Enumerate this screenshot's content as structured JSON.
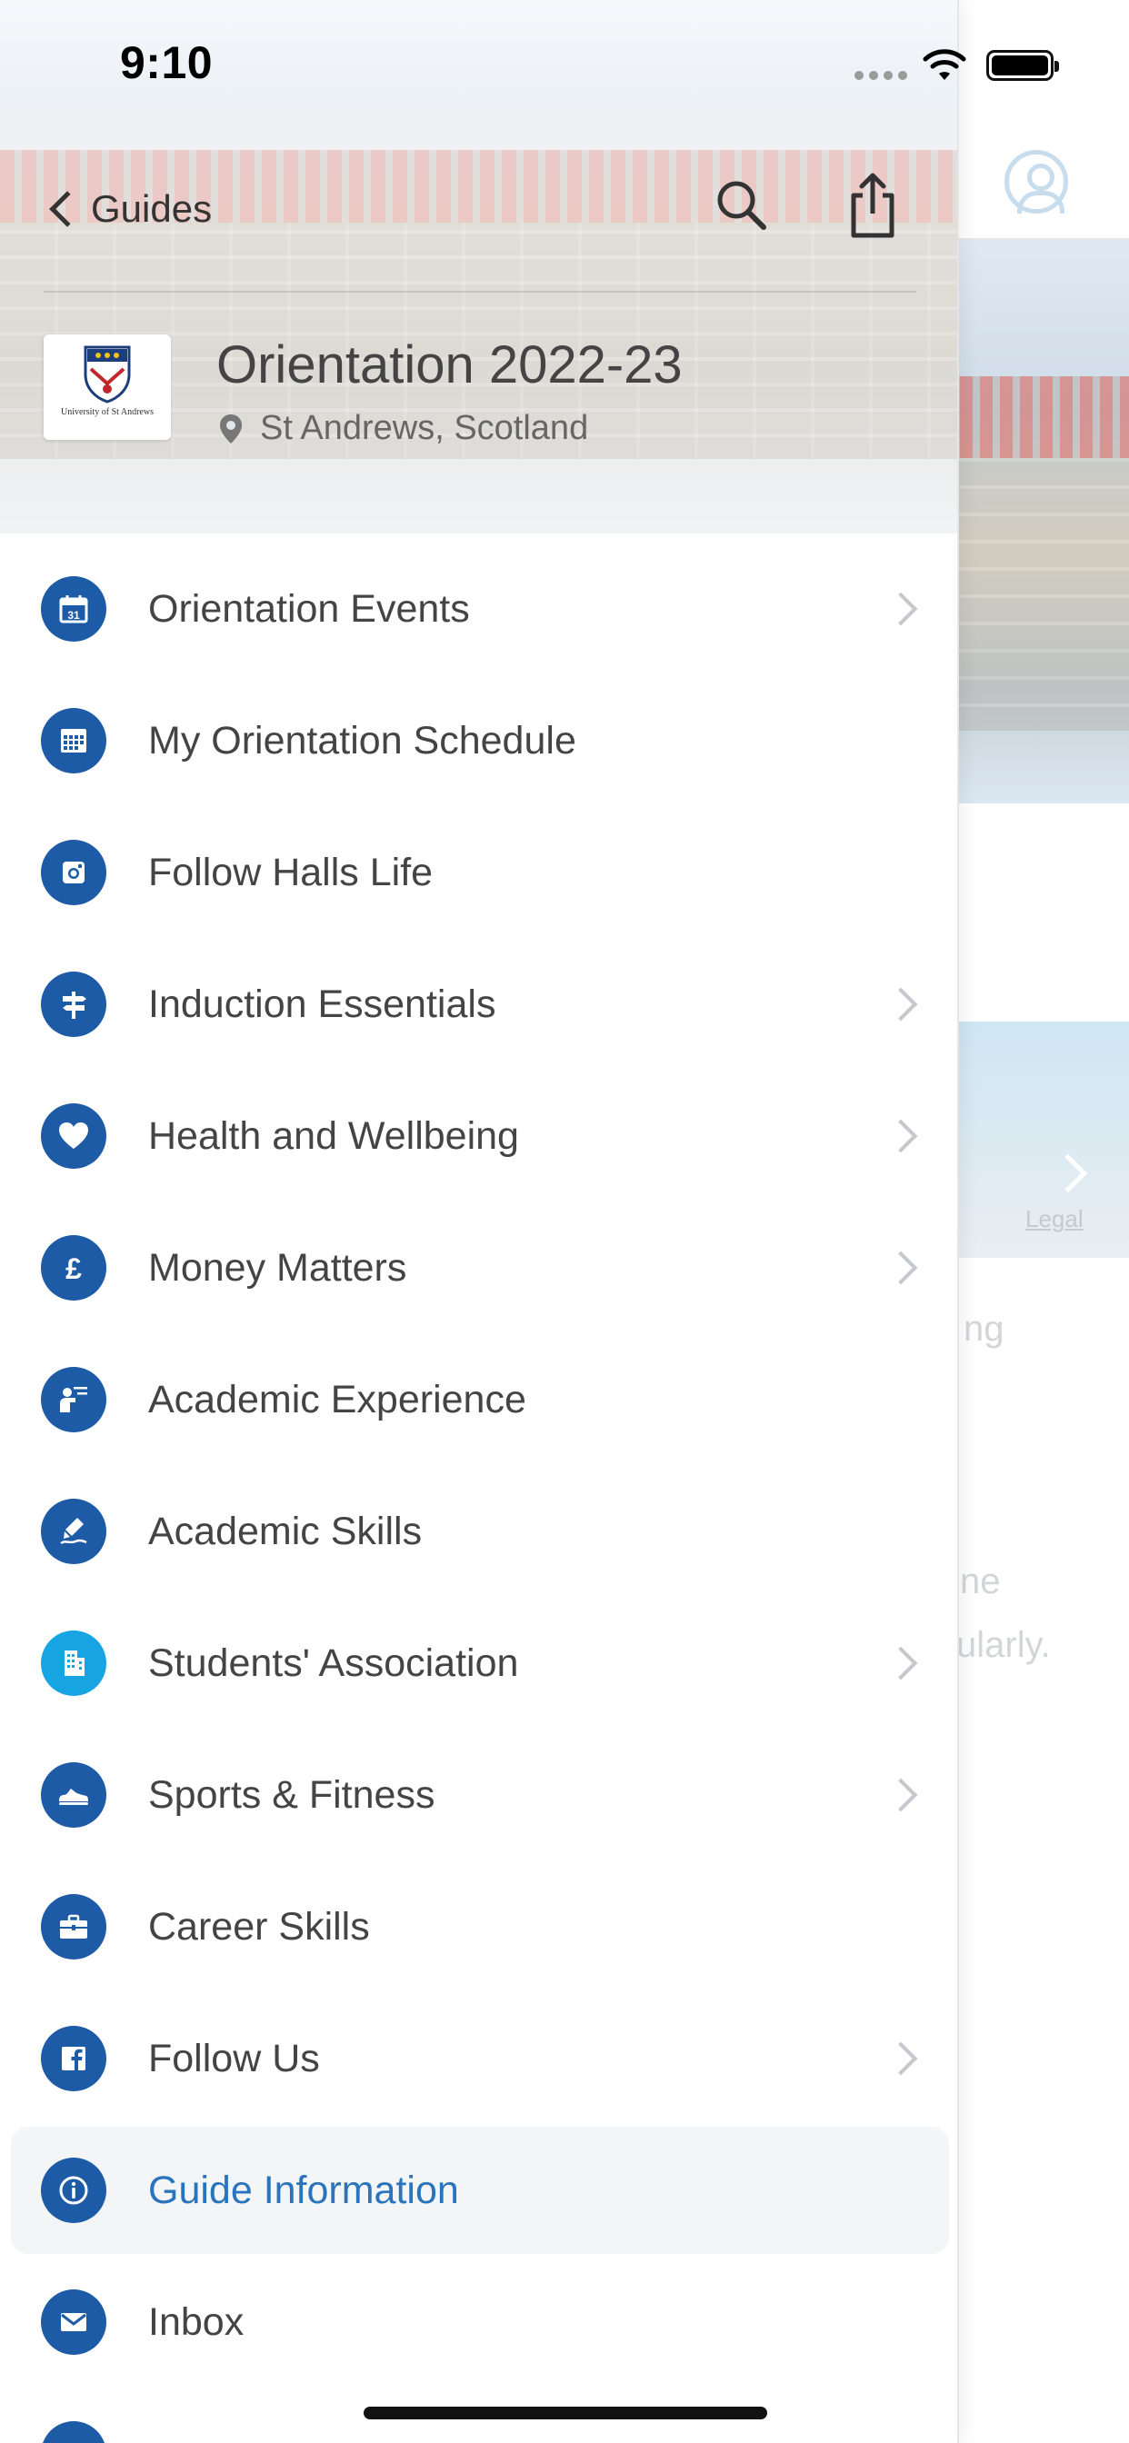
{
  "status_bar": {
    "time": "9:10"
  },
  "nav": {
    "back_label": "Guides"
  },
  "guide": {
    "title": "Orientation 2022-23",
    "location": "St Andrews, Scotland",
    "logo_text": "University of St Andrews"
  },
  "menu": {
    "items": [
      {
        "label": "Orientation Events",
        "icon": "calendar-icon",
        "chevron": true
      },
      {
        "label": "My Orientation Schedule",
        "icon": "schedule-grid-icon",
        "chevron": false
      },
      {
        "label": "Follow Halls Life",
        "icon": "instagram-icon",
        "chevron": false
      },
      {
        "label": "Induction Essentials",
        "icon": "signpost-icon",
        "chevron": true
      },
      {
        "label": "Health and Wellbeing",
        "icon": "heart-icon",
        "chevron": true
      },
      {
        "label": "Money Matters",
        "icon": "pound-icon",
        "chevron": true
      },
      {
        "label": "Academic Experience",
        "icon": "lecturer-icon",
        "chevron": false
      },
      {
        "label": "Academic Skills",
        "icon": "writing-hand-icon",
        "chevron": false
      },
      {
        "label": "Students' Association",
        "icon": "building-icon",
        "chevron": true
      },
      {
        "label": "Sports & Fitness",
        "icon": "sneaker-icon",
        "chevron": true
      },
      {
        "label": "Career Skills",
        "icon": "briefcase-icon",
        "chevron": false
      },
      {
        "label": "Follow Us",
        "icon": "facebook-icon",
        "chevron": true
      },
      {
        "label": "Guide Information",
        "icon": "info-icon",
        "chevron": false,
        "active": true
      },
      {
        "label": "Inbox",
        "icon": "mail-icon",
        "chevron": false
      }
    ]
  },
  "background_page": {
    "legal_label": "Legal",
    "text_fragments": [
      "ng",
      "ne",
      "ularly."
    ]
  },
  "colors": {
    "icon_blue": "#1d5ba7",
    "icon_light_blue": "#17a4e3",
    "active_label": "#2a74bd",
    "label_text": "#444444"
  }
}
